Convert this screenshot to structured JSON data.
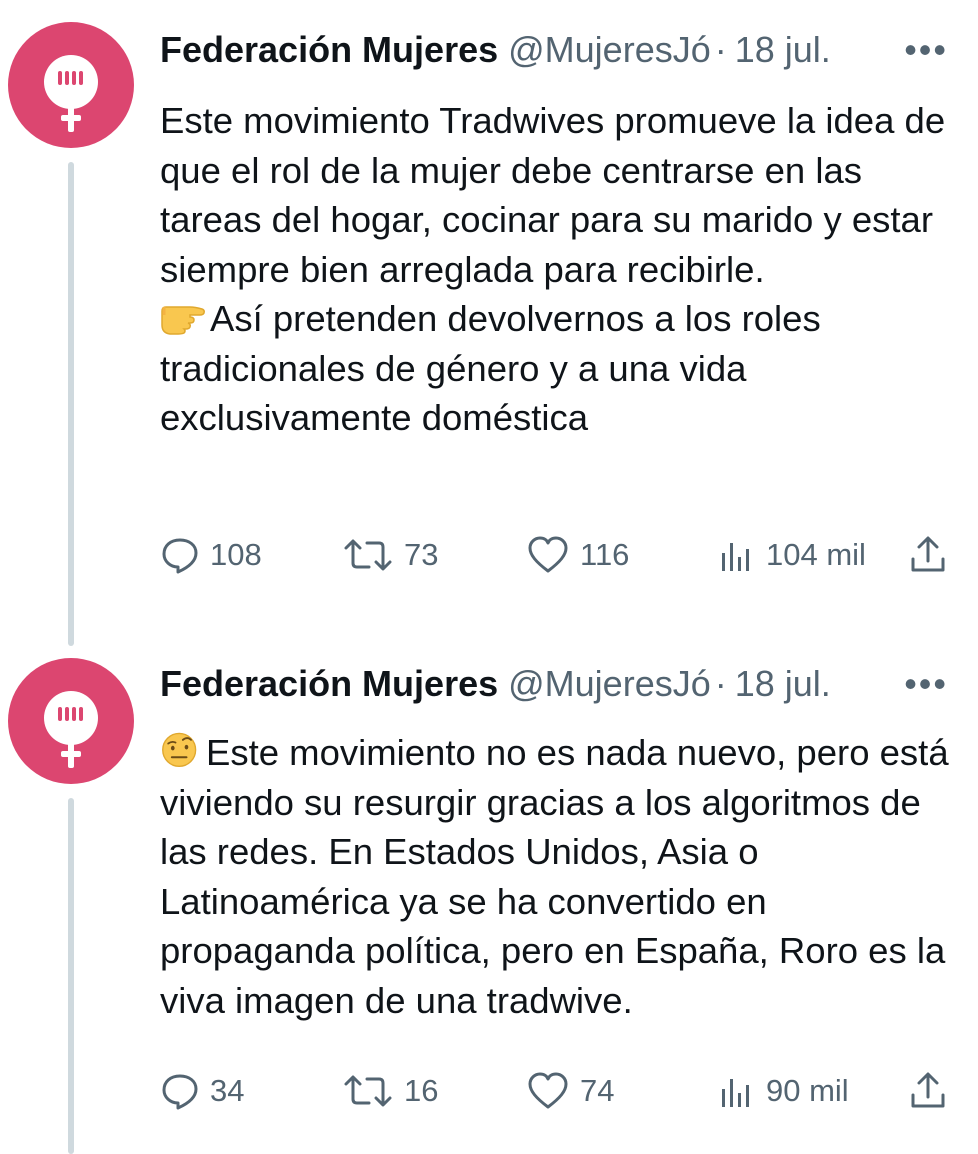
{
  "tweets": [
    {
      "author": {
        "name": "Federación Mujeres",
        "handle": "@MujeresJó",
        "avatar_icon": "female-symbol-icon",
        "avatar_color": "#dc4670"
      },
      "separator": "·",
      "date": "18 jul.",
      "more_label": "•••",
      "paragraphs": [
        "Este movimiento Tradwives promueve la idea de que el rol de la mujer debe centrarse en las tareas del hogar, cocinar para su marido y estar siempre bien arreglada para recibirle.",
        "Así pretenden devolvernos a los roles tradicionales de género y a una vida exclusivamente doméstica"
      ],
      "lead_emoji": "backhand-index-pointing-right-emoji",
      "stats": {
        "replies": "108",
        "reposts": "73",
        "likes": "116",
        "views": "104 mil"
      }
    },
    {
      "author": {
        "name": "Federación Mujeres",
        "handle": "@MujeresJó",
        "avatar_icon": "female-symbol-icon",
        "avatar_color": "#dc4670"
      },
      "separator": "·",
      "date": "18 jul.",
      "more_label": "•••",
      "paragraphs": [
        "Este movimiento no es nada nuevo, pero está viviendo su resurgir gracias a los algoritmos de las redes. En Estados Unidos, Asia o Latinoamérica ya se ha convertido en propaganda política, pero en España, Roro es la viva imagen de una tradwive."
      ],
      "lead_emoji": "face-with-raised-eyebrow-emoji",
      "stats": {
        "replies": "34",
        "reposts": "16",
        "likes": "74",
        "views": "90 mil"
      }
    }
  ],
  "colors": {
    "text": "#0f1419",
    "secondary": "#536471",
    "thread_line": "#cfd9de",
    "background": "#ffffff"
  }
}
